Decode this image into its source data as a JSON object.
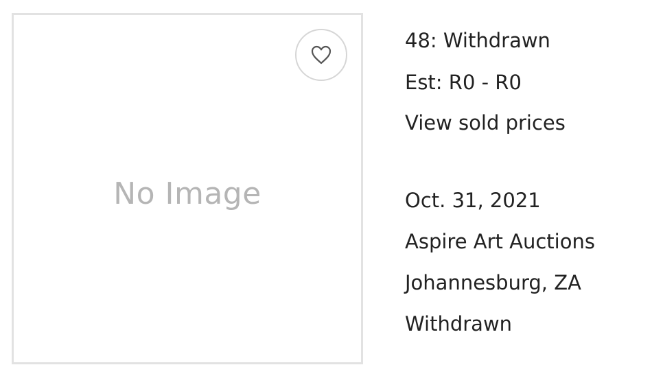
{
  "image": {
    "placeholder_text": "No Image"
  },
  "favorite": {
    "icon": "heart-outline-icon"
  },
  "lot": {
    "title": "48: Withdrawn",
    "estimate": "Est: R0 - R0",
    "sold_prices_link": "View sold prices"
  },
  "auction": {
    "date": "Oct. 31, 2021",
    "house": "Aspire Art Auctions",
    "location": "Johannesburg, ZA",
    "status": "Withdrawn"
  },
  "colors": {
    "text": "#222222",
    "placeholder_text": "#b5b5b5",
    "border": "#e2e2e2",
    "icon_stroke": "#555555"
  }
}
